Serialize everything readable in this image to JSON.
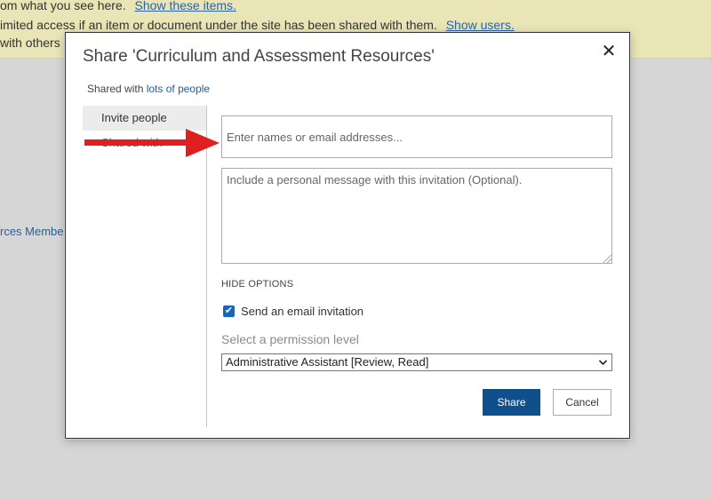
{
  "banner": {
    "line1_text": "om what you see here.",
    "line1_link": "Show these items.",
    "line2_text": "imited access if an item or document under the site has been shared with them.",
    "line2_link": "Show users.",
    "line3_text": "with others"
  },
  "background": {
    "link_fragment": "rces Member"
  },
  "dialog": {
    "title": "Share 'Curriculum and Assessment Resources'",
    "close_symbol": "✕",
    "shared_with_prefix": "Shared with",
    "shared_with_link": "lots of people",
    "nav": {
      "invite_people": "Invite people",
      "shared_with": "Shared with"
    },
    "names_input": {
      "placeholder": "Enter names or email addresses...",
      "value": ""
    },
    "message_input": {
      "placeholder": "Include a personal message with this invitation (Optional).",
      "value": ""
    },
    "hide_options": "HIDE OPTIONS",
    "send_email": {
      "label": "Send an email invitation",
      "checked": true
    },
    "permission": {
      "label": "Select a permission level",
      "selected": "Administrative Assistant [Review, Read]"
    },
    "buttons": {
      "share": "Share",
      "cancel": "Cancel"
    }
  },
  "annotation": {
    "arrow_color": "#e02020"
  },
  "colors": {
    "accent": "#0f4f8c",
    "link": "#1f5fa0",
    "banner": "#e9e5b6"
  }
}
